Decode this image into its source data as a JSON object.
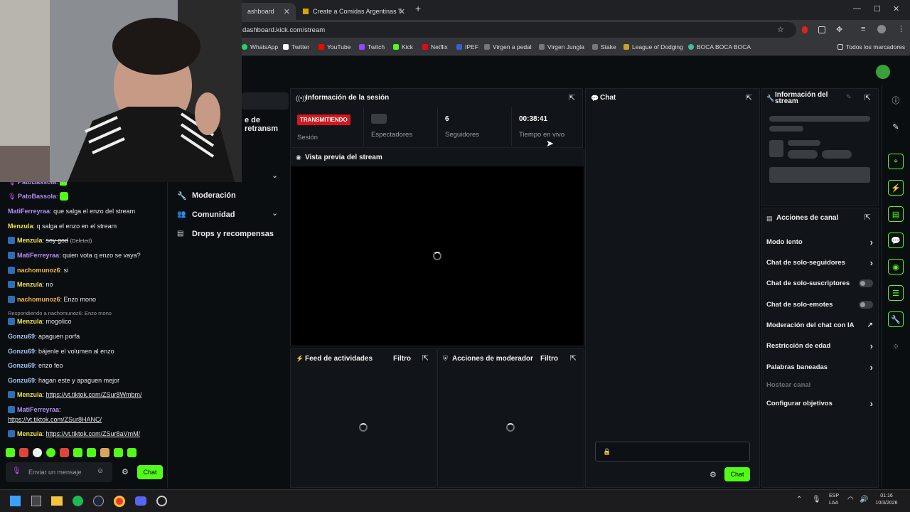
{
  "browser": {
    "tabs": [
      {
        "label": "ashboard"
      },
      {
        "label": "Create a Comidas Argentinas T"
      }
    ],
    "new_tab": "+",
    "url": "dashboard.kick.com/stream",
    "bookmarks": [
      "WhatsApp",
      "Twitter",
      "YouTube",
      "Twitch",
      "Kick",
      "Netflix",
      "IPEF",
      "Virgen a pedal",
      "Virgen Jungla",
      "Stake",
      "League of Dodging",
      "BOCA BOCA BOCA"
    ],
    "all_bookmarks": "Todos los marcadores"
  },
  "left_nav": {
    "partial_item": "e de retransm",
    "items": [
      "Moderación",
      "Comunidad",
      "Drops y recompensas"
    ]
  },
  "left_chat": {
    "messages": [
      {
        "user": "PatoBassola",
        "text": "",
        "color": "#b48cf2"
      },
      {
        "user": "PatoBassola",
        "text": "",
        "color": "#b48cf2"
      },
      {
        "user": "MatiFerreyraa",
        "text": "que salga el enzo del stream",
        "color": "#b48cf2"
      },
      {
        "user": "Menzula",
        "text": "q salga el enzo en el stream",
        "color": "#f2e14c"
      },
      {
        "user": "Menzula",
        "text": "soy god",
        "deleted": "(Deleted)",
        "color": "#f2e14c"
      },
      {
        "user": "MatiFerreyraa",
        "text": "quien vota q enzo se vaya?",
        "color": "#b48cf2"
      },
      {
        "user": "nachomunoz6",
        "text": "si",
        "color": "#f2b24c"
      },
      {
        "user": "Menzula",
        "text": "no",
        "color": "#f2e14c"
      },
      {
        "user": "nachomunoz6",
        "text": "Enzo mono",
        "color": "#f2b24c"
      },
      {
        "user": "Menzula",
        "text": "mogolico",
        "color": "#f2e14c"
      },
      {
        "user": "Gonzu69",
        "text": "apaguen porfa",
        "color": "#9ec3f2"
      },
      {
        "user": "Gonzu69",
        "text": "bájenle el volumen al enzo",
        "color": "#9ec3f2"
      },
      {
        "user": "Gonzu69",
        "text": "enzo feo",
        "color": "#9ec3f2"
      },
      {
        "user": "Gonzu69",
        "text": "hagan este y apaguen mejor",
        "color": "#9ec3f2"
      },
      {
        "user": "Menzula",
        "text": "https://vt.tiktok.com/ZSur8Wmbm/",
        "color": "#f2e14c"
      },
      {
        "user": "MatiFerreyraa",
        "text": "https://vt.tiktok.com/ZSur8HANC/",
        "color": "#b48cf2"
      },
      {
        "user": "Menzula",
        "text": "https://vt.tiktok.com/ZSur8aVmM/",
        "color": "#f2e14c"
      }
    ],
    "reply_note": "Respondiendo a nachomunoz6: Enzo mono",
    "input_placeholder": "Enviar un mensaje",
    "send_label": "Chat"
  },
  "session": {
    "title": "Información de la sesión",
    "live_badge": "TRANSMITIENDO",
    "session_label": "Sesión",
    "viewers_label": "Espectadores",
    "followers_value": "6",
    "followers_label": "Seguidores",
    "time_value": "00:38:41",
    "time_label": "Tiempo en vivo"
  },
  "preview": {
    "title": "Vista previa del stream"
  },
  "activity": {
    "title": "Feed de actividades",
    "filter": "Filtro"
  },
  "mod_actions": {
    "title": "Acciones de moderador",
    "filter": "Filtro"
  },
  "chat_panel": {
    "title": "Chat",
    "send_label": "Chat"
  },
  "stream_info": {
    "title_line1": "Información del",
    "title_line2": "stream"
  },
  "channel_actions": {
    "title": "Acciones de canal",
    "items": [
      {
        "label": "Modo lento",
        "control": "chevron"
      },
      {
        "label": "Chat de solo-seguidores",
        "control": "chevron"
      },
      {
        "label": "Chat de solo-suscriptores",
        "control": "toggle"
      },
      {
        "label": "Chat de solo-emotes",
        "control": "toggle"
      },
      {
        "label": "Moderación del chat con IA",
        "control": "external"
      },
      {
        "label": "Restricción de edad",
        "control": "chevron"
      },
      {
        "label": "Palabras baneadas",
        "control": "chevron"
      },
      {
        "label": "Hostear canal",
        "control": "none",
        "disabled": true
      },
      {
        "label": "Configurar objetivos",
        "control": "chevron"
      }
    ]
  },
  "taskbar": {
    "lang1": "ESP",
    "lang2": "LAA",
    "time": "01:16",
    "date": "10/3/2026"
  },
  "colors": {
    "accent": "#53fc18",
    "live": "#d4171e",
    "bg": "#0b0e11",
    "panel": "#111418"
  }
}
